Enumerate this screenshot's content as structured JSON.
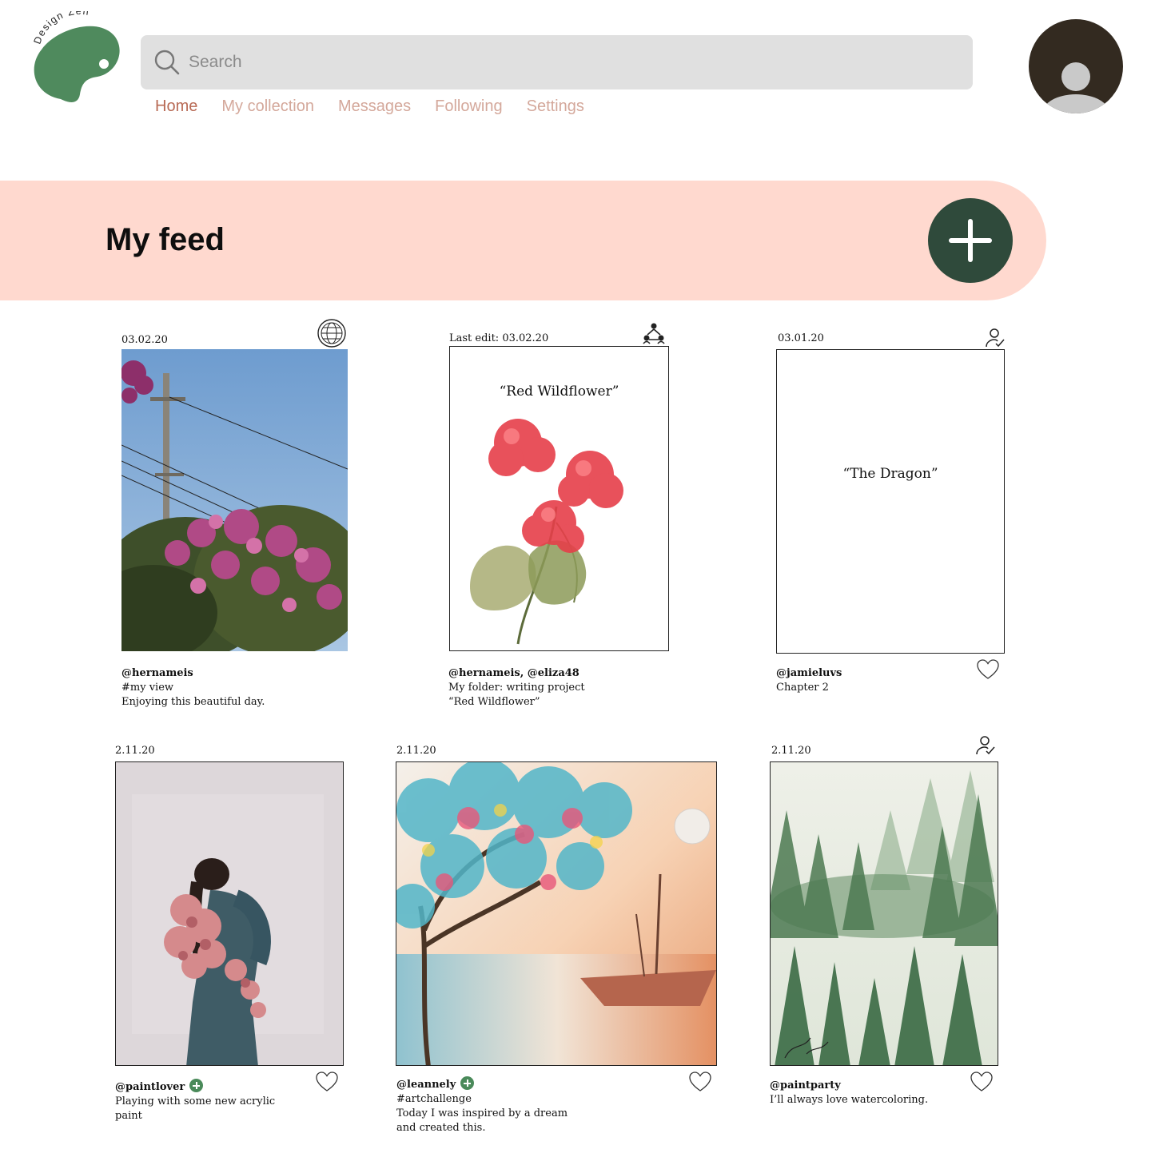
{
  "brand": {
    "name": "Design Zen",
    "color": "#4f8a5d"
  },
  "search": {
    "placeholder": "Search"
  },
  "nav": {
    "items": [
      {
        "label": "Home",
        "active": true
      },
      {
        "label": "My collection"
      },
      {
        "label": "Messages"
      },
      {
        "label": "Following"
      },
      {
        "label": "Settings"
      }
    ]
  },
  "feed": {
    "title": "My feed"
  },
  "posts": [
    {
      "date": "03.02.20",
      "status_icon": "globe-icon",
      "user": "@hernameis",
      "lines": [
        "#my view",
        "Enjoying this beautiful day."
      ]
    },
    {
      "date": "Last edit: 03.02.20",
      "status_icon": "collaborators-icon",
      "doc_title": "“Red Wildflower”",
      "user": "@hernameis, @eliza48",
      "lines": [
        "My folder: writing project",
        "“Red Wildflower”"
      ]
    },
    {
      "date": "03.01.20",
      "status_icon": "user-check-icon",
      "doc_title": "“The Dragon”",
      "user": "@jamieluvs",
      "lines": [
        "Chapter 2"
      ]
    },
    {
      "date": "2.11.20",
      "user": "@paintlover",
      "lines": [
        "Playing with some new acrylic",
        "paint"
      ]
    },
    {
      "date": "2.11.20",
      "user": "@leannely",
      "lines": [
        "#artchallenge",
        "Today I was inspired by a dream",
        "and created this."
      ]
    },
    {
      "date": "2.11.20",
      "status_icon": "user-check-icon",
      "user": "@paintparty",
      "lines": [
        "I’ll always love watercoloring."
      ]
    }
  ]
}
